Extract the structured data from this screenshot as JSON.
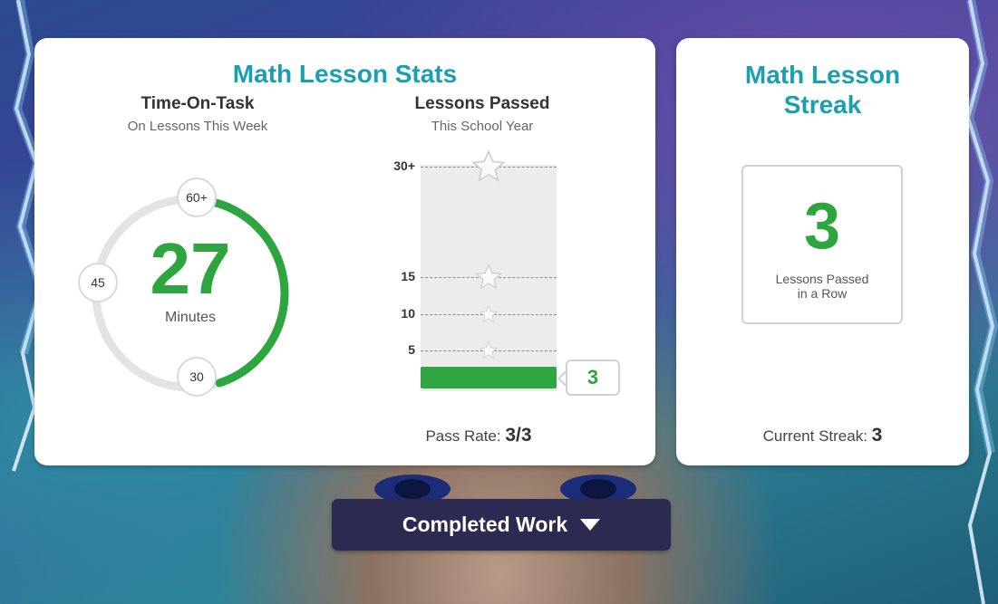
{
  "colors": {
    "accent_teal": "#1a9fb1",
    "progress_green": "#2ea640",
    "button_dark": "#2d2a52"
  },
  "stats": {
    "title": "Math Lesson Stats",
    "time_on_task": {
      "title": "Time-On-Task",
      "caption": "On Lessons This Week",
      "value": "27",
      "unit": "Minutes",
      "fraction_of_max": 0.45,
      "markers": [
        "60+",
        "45",
        "30"
      ]
    },
    "lessons_passed": {
      "title": "Lessons Passed",
      "caption": "This School Year",
      "ticks": [
        "30+",
        "15",
        "10",
        "5"
      ],
      "tick_values": [
        30,
        15,
        10,
        5
      ],
      "max": 30,
      "value_label": "3",
      "value": 3
    },
    "pass_rate_label": "Pass Rate:",
    "pass_rate_value": "3/3"
  },
  "streak": {
    "title_line1": "Math Lesson",
    "title_line2": "Streak",
    "value": "3",
    "caption_line1": "Lessons Passed",
    "caption_line2": "in a Row",
    "current_label": "Current Streak:",
    "current_value": "3"
  },
  "completed_work": {
    "label": "Completed Work"
  }
}
